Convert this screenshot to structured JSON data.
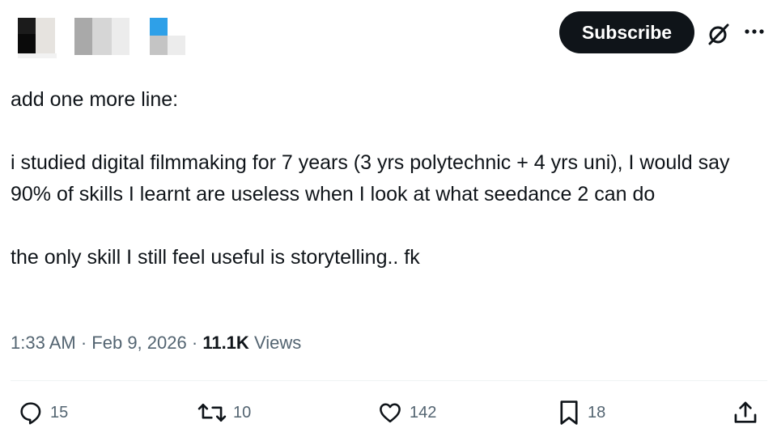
{
  "header": {
    "subscribe_label": "Subscribe",
    "grok_icon": "grok-icon",
    "more_icon": "more-icon"
  },
  "tweet": {
    "lines": [
      "add one more line:",
      "i studied digital filmmaking for 7 years (3 yrs polytechnic + 4 yrs uni), I would say 90% of skills I learnt are useless when I look at what seedance 2 can do",
      "the only skill I still feel useful is storytelling.. fk"
    ],
    "time": "1:33 AM",
    "date": "Feb 9, 2026",
    "separator": "·",
    "views_count": "11.1K",
    "views_label": "Views"
  },
  "actions": {
    "replies": "15",
    "reposts": "10",
    "likes": "142",
    "bookmarks": "18"
  },
  "colors": {
    "text": "#0f1419",
    "secondary": "#536471",
    "button_bg": "#0f1419",
    "divider": "#eff3f4"
  }
}
